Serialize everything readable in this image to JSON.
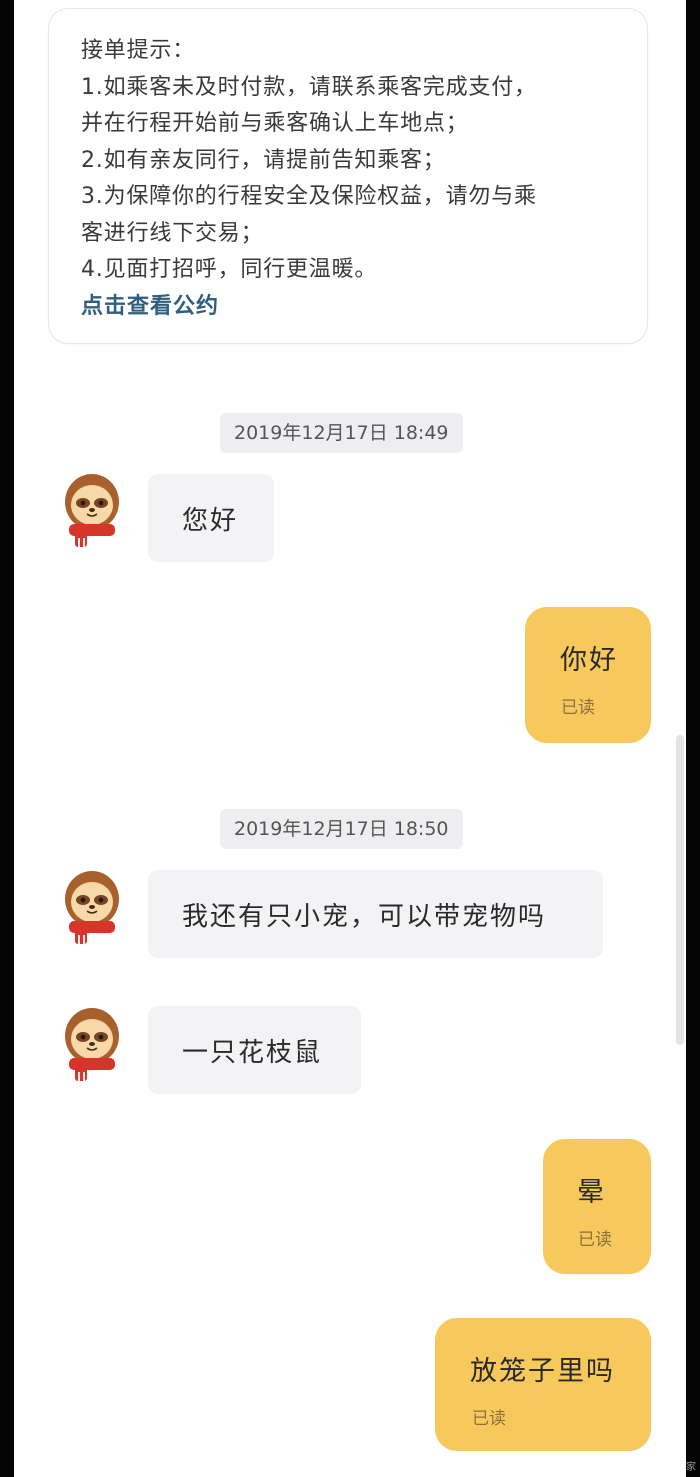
{
  "notice": {
    "title": "接单提示：",
    "lines": [
      "1.如乘客未及时付款，请联系乘客完成支付，",
      "并在行程开始前与乘客确认上车地点；",
      "2.如有亲友同行，请提前告知乘客；",
      "3.为保障你的行程安全及保险权益，请勿与乘",
      "客进行线下交易；",
      "4.见面打招呼，同行更温暖。"
    ],
    "link": "点击查看公约"
  },
  "timestamps": [
    "2019年12月17日  18:49",
    "2019年12月17日  18:50"
  ],
  "messages": [
    {
      "side": "incoming",
      "text": "您好"
    },
    {
      "side": "outgoing",
      "text": "你好",
      "status": "已读"
    },
    {
      "side": "incoming",
      "text": "我还有只小宠，可以带宠物吗"
    },
    {
      "side": "incoming",
      "text": "一只花枝鼠"
    },
    {
      "side": "outgoing",
      "text": "晕",
      "status": "已读"
    },
    {
      "side": "outgoing",
      "text": "放笼子里吗",
      "status": "已读"
    }
  ],
  "corner_mark": "家",
  "colors": {
    "outgoing_bubble": "#f7c85b",
    "incoming_bubble": "#f3f3f5",
    "link": "#2f5f7c",
    "timestamp_bg": "#eeeef1"
  },
  "icons": {
    "avatar": "sloth-with-red-scarf-avatar"
  }
}
